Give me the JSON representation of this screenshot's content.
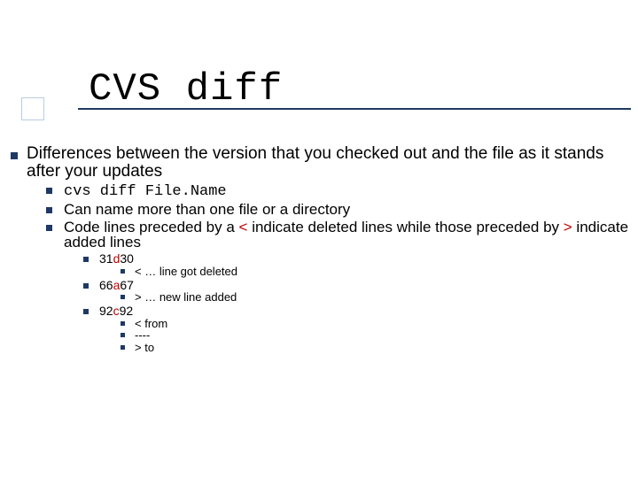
{
  "title": "CVS diff",
  "intro": "Differences between the version that you checked out and the file as it stands after your updates",
  "sub": {
    "cmd": "cvs diff File.Name",
    "multi": "Can name more than one file or a directory",
    "explain_a": "Code lines preceded by a ",
    "explain_lt": "<",
    "explain_b": " indicate deleted lines while those preceded by ",
    "explain_gt": ">",
    "explain_c": " indicate added lines"
  },
  "ex1": {
    "a": "31",
    "op": "d",
    "b": "30",
    "note": "< … line got deleted"
  },
  "ex2": {
    "a": "66",
    "op": "a",
    "b": "67",
    "note": "> … new line added"
  },
  "ex3": {
    "a": "92",
    "op": "c",
    "b": "92",
    "l1": "< from",
    "l2": "----",
    "l3": "> to"
  }
}
